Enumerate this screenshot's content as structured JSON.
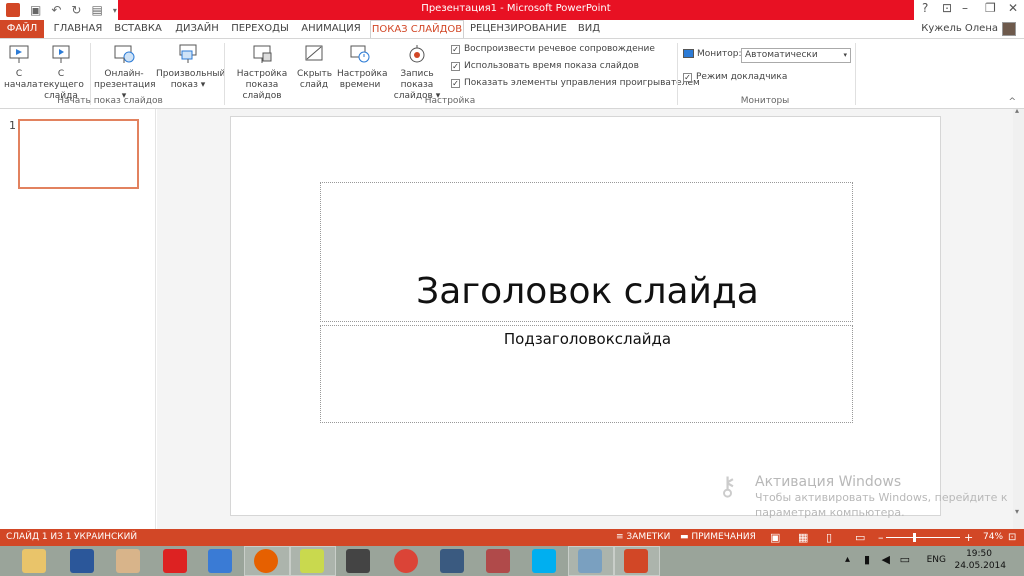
{
  "window": {
    "title": "Презентация1 - Microsoft PowerPoint",
    "help": "?",
    "minimize": "–",
    "restore": "❐",
    "close": "✕"
  },
  "user": {
    "name": "Кужель Олена"
  },
  "tabs": [
    {
      "label": "ФАЙЛ"
    },
    {
      "label": "ГЛАВНАЯ"
    },
    {
      "label": "ВСТАВКА"
    },
    {
      "label": "ДИЗАЙН"
    },
    {
      "label": "ПЕРЕХОДЫ"
    },
    {
      "label": "АНИМАЦИЯ"
    },
    {
      "label": "ПОКАЗ СЛАЙДОВ"
    },
    {
      "label": "РЕЦЕНЗИРОВАНИЕ"
    },
    {
      "label": "ВИД"
    }
  ],
  "ribbon": {
    "start_group": {
      "label": "Начать показ слайдов",
      "btn_from_start": [
        "С",
        "начала"
      ],
      "btn_from_current": [
        "С текущего",
        "слайда"
      ],
      "btn_online": [
        "Онлайн-",
        "презентация ▾"
      ],
      "btn_custom": [
        "Произвольный",
        "показ ▾"
      ]
    },
    "setup_group": {
      "label": "Настройка",
      "btn_setup": [
        "Настройка",
        "показа слайдов"
      ],
      "btn_hide": [
        "Скрыть",
        "слайд"
      ],
      "btn_rehearse": [
        "Настройка",
        "времени"
      ],
      "btn_record": [
        "Запись показа",
        "слайдов ▾"
      ],
      "chk_narration": "Воспроизвести речевое сопровождение",
      "chk_timings": "Использовать время показа слайдов",
      "chk_controls": "Показать элементы управления проигрывателем"
    },
    "monitors_group": {
      "label": "Мониторы",
      "monitor_label": "Монитор:",
      "monitor_value": "Автоматически",
      "chk_presenter": "Режим докладчика"
    }
  },
  "thumbnails": {
    "number": "1"
  },
  "slide": {
    "title": "Заголовок слайда",
    "subtitle": "Подзаголовокслайда"
  },
  "watermark": {
    "line1": "Активация Windows",
    "line2": "Чтобы активировать Windows, перейдите к",
    "line3": "параметрам компьютера."
  },
  "status": {
    "slide_info": "СЛАЙД 1 ИЗ 1",
    "language": "УКРАИНСКИЙ",
    "notes": "≡ ЗАМЕТКИ",
    "comments": "▬ ПРИМЕЧАНИЯ",
    "zoom_minus": "–",
    "zoom_plus": "+",
    "zoom": "74%"
  },
  "tray": {
    "lang": "ENG",
    "time": "19:50",
    "date": "24.05.2014"
  },
  "colors": {
    "accent": "#d24726",
    "titlebar": "#e81123",
    "taskbar": "#9aa49a"
  }
}
